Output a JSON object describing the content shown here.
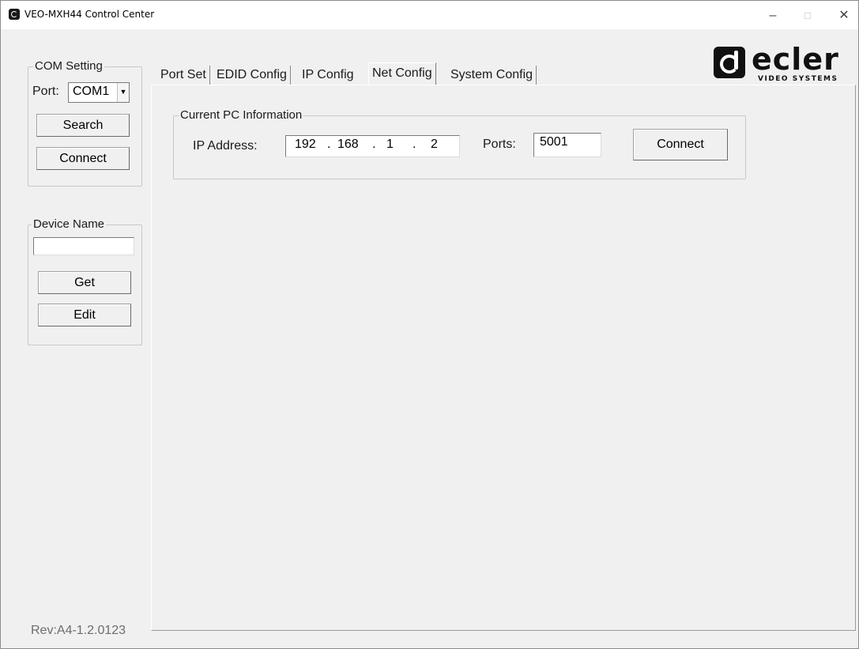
{
  "window": {
    "title": "VEO-MXH44 Control Center"
  },
  "com_setting": {
    "legend": "COM Setting",
    "port_label": "Port:",
    "port_value": "COM1",
    "search_label": "Search",
    "connect_label": "Connect"
  },
  "device_name": {
    "legend": "Device Name",
    "value": "",
    "get_label": "Get",
    "edit_label": "Edit"
  },
  "tabs": [
    {
      "label": "Port Set"
    },
    {
      "label": "EDID Config"
    },
    {
      "label": "IP Config"
    },
    {
      "label": "Net Config",
      "active": true
    },
    {
      "label": "System Config"
    }
  ],
  "net_config": {
    "group_legend": "Current PC Information",
    "ip_label": "IP Address:",
    "ip": [
      "192",
      "168",
      "1",
      "2"
    ],
    "ports_label": "Ports:",
    "ports_value": "5001",
    "connect_label": "Connect"
  },
  "logo": {
    "text": "ecler",
    "subtitle": "VIDEO SYSTEMS"
  },
  "revision": "Rev:A4-1.2.0123"
}
